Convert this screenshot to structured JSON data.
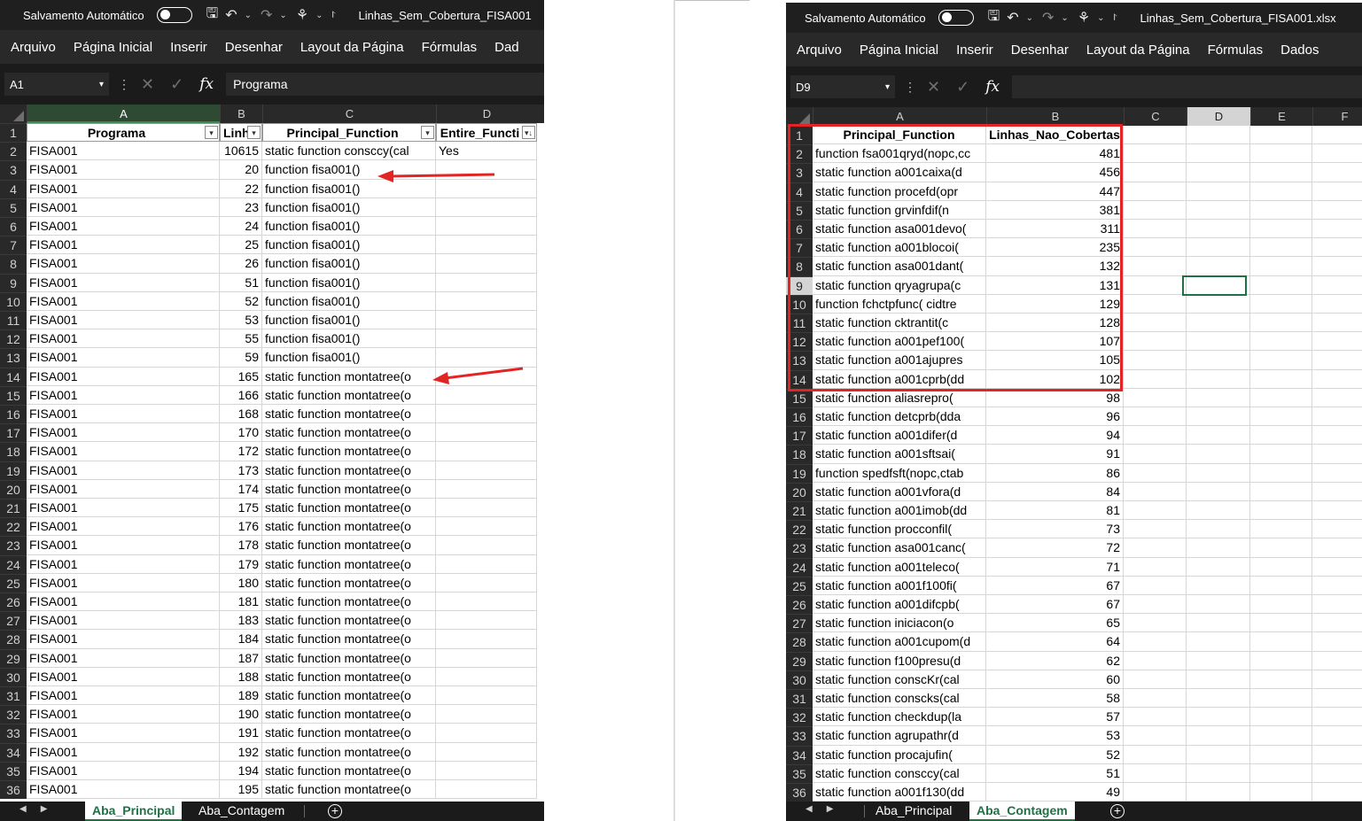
{
  "left": {
    "autosave_label": "Salvamento Automático",
    "filename": "Linhas_Sem_Cobertura_FISA001",
    "menu": [
      "Arquivo",
      "Página Inicial",
      "Inserir",
      "Desenhar",
      "Layout da Página",
      "Fórmulas",
      "Dad"
    ],
    "name_box": "A1",
    "formula": "Programa",
    "columns": [
      "A",
      "B",
      "C",
      "D"
    ],
    "headers": [
      "Programa",
      "Linh",
      "Principal_Function",
      "Entire_Functi"
    ],
    "rows": [
      [
        "FISA001",
        "10615",
        "static function consccy(cal",
        "Yes"
      ],
      [
        "FISA001",
        "20",
        "function fisa001()",
        ""
      ],
      [
        "FISA001",
        "22",
        "function fisa001()",
        ""
      ],
      [
        "FISA001",
        "23",
        "function fisa001()",
        ""
      ],
      [
        "FISA001",
        "24",
        "function fisa001()",
        ""
      ],
      [
        "FISA001",
        "25",
        "function fisa001()",
        ""
      ],
      [
        "FISA001",
        "26",
        "function fisa001()",
        ""
      ],
      [
        "FISA001",
        "51",
        "function fisa001()",
        ""
      ],
      [
        "FISA001",
        "52",
        "function fisa001()",
        ""
      ],
      [
        "FISA001",
        "53",
        "function fisa001()",
        ""
      ],
      [
        "FISA001",
        "55",
        "function fisa001()",
        ""
      ],
      [
        "FISA001",
        "59",
        "function fisa001()",
        ""
      ],
      [
        "FISA001",
        "165",
        "static function montatree(o",
        ""
      ],
      [
        "FISA001",
        "166",
        "static function montatree(o",
        ""
      ],
      [
        "FISA001",
        "168",
        "static function montatree(o",
        ""
      ],
      [
        "FISA001",
        "170",
        "static function montatree(o",
        ""
      ],
      [
        "FISA001",
        "172",
        "static function montatree(o",
        ""
      ],
      [
        "FISA001",
        "173",
        "static function montatree(o",
        ""
      ],
      [
        "FISA001",
        "174",
        "static function montatree(o",
        ""
      ],
      [
        "FISA001",
        "175",
        "static function montatree(o",
        ""
      ],
      [
        "FISA001",
        "176",
        "static function montatree(o",
        ""
      ],
      [
        "FISA001",
        "178",
        "static function montatree(o",
        ""
      ],
      [
        "FISA001",
        "179",
        "static function montatree(o",
        ""
      ],
      [
        "FISA001",
        "180",
        "static function montatree(o",
        ""
      ],
      [
        "FISA001",
        "181",
        "static function montatree(o",
        ""
      ],
      [
        "FISA001",
        "183",
        "static function montatree(o",
        ""
      ],
      [
        "FISA001",
        "184",
        "static function montatree(o",
        ""
      ],
      [
        "FISA001",
        "187",
        "static function montatree(o",
        ""
      ],
      [
        "FISA001",
        "188",
        "static function montatree(o",
        ""
      ],
      [
        "FISA001",
        "189",
        "static function montatree(o",
        ""
      ],
      [
        "FISA001",
        "190",
        "static function montatree(o",
        ""
      ],
      [
        "FISA001",
        "191",
        "static function montatree(o",
        ""
      ],
      [
        "FISA001",
        "192",
        "static function montatree(o",
        ""
      ],
      [
        "FISA001",
        "194",
        "static function montatree(o",
        ""
      ],
      [
        "FISA001",
        "195",
        "static function montatree(o",
        ""
      ]
    ],
    "sheet_tabs": [
      "Aba_Principal",
      "Aba_Contagem"
    ],
    "active_tab": 0
  },
  "right": {
    "autosave_label": "Salvamento Automático",
    "filename": "Linhas_Sem_Cobertura_FISA001.xlsx",
    "menu": [
      "Arquivo",
      "Página Inicial",
      "Inserir",
      "Desenhar",
      "Layout da Página",
      "Fórmulas",
      "Dados"
    ],
    "name_box": "D9",
    "formula": "",
    "columns": [
      "A",
      "B",
      "C",
      "D",
      "E",
      "F"
    ],
    "headers": [
      "Principal_Function",
      "Linhas_Nao_Cobertas"
    ],
    "rows": [
      [
        "function fsa001qryd(nopc,cc",
        "481"
      ],
      [
        "static function a001caixa(d",
        "456"
      ],
      [
        "static function procefd(opr",
        "447"
      ],
      [
        "static function grvinfdif(n",
        "381"
      ],
      [
        "static function asa001devo(",
        "311"
      ],
      [
        "static function a001blocoi(",
        "235"
      ],
      [
        "static function asa001dant(",
        "132"
      ],
      [
        "static function qryagrupa(c",
        "131"
      ],
      [
        "function fchctpfunc( cidtre",
        "129"
      ],
      [
        "static function cktrantit(c",
        "128"
      ],
      [
        "static function a001pef100(",
        "107"
      ],
      [
        "static function a001ajupres",
        "105"
      ],
      [
        "static function a001cprb(dd",
        "102"
      ],
      [
        "static function aliasrepro(",
        "98"
      ],
      [
        "static function detcprb(dda",
        "96"
      ],
      [
        "static function a001difer(d",
        "94"
      ],
      [
        "static function a001sftsai(",
        "91"
      ],
      [
        "function spedfsft(nopc,ctab",
        "86"
      ],
      [
        "static function a001vfora(d",
        "84"
      ],
      [
        "static function a001imob(dd",
        "81"
      ],
      [
        "static function procconfil(",
        "73"
      ],
      [
        "static function asa001canc(",
        "72"
      ],
      [
        "static function a001teleco(",
        "71"
      ],
      [
        "static function a001f100fi(",
        "67"
      ],
      [
        "static function a001difcpb(",
        "67"
      ],
      [
        "static function iniciacon(o",
        "65"
      ],
      [
        "static function a001cupom(d",
        "64"
      ],
      [
        "static function f100presu(d",
        "62"
      ],
      [
        "static function conscKr(cal",
        "60"
      ],
      [
        "static function conscks(cal",
        "58"
      ],
      [
        "static function checkdup(la",
        "57"
      ],
      [
        "static function agrupathr(d",
        "53"
      ],
      [
        "static function procajufin(",
        "52"
      ],
      [
        "static function consccy(cal",
        "51"
      ],
      [
        "static function a001f130(dd",
        "49"
      ]
    ],
    "sheet_tabs": [
      "Aba_Principal",
      "Aba_Contagem"
    ],
    "active_tab": 1
  },
  "colors": {
    "excel_green": "#1e7145",
    "highlight_red": "#e32424",
    "annotation_arrow": "#e32424"
  }
}
